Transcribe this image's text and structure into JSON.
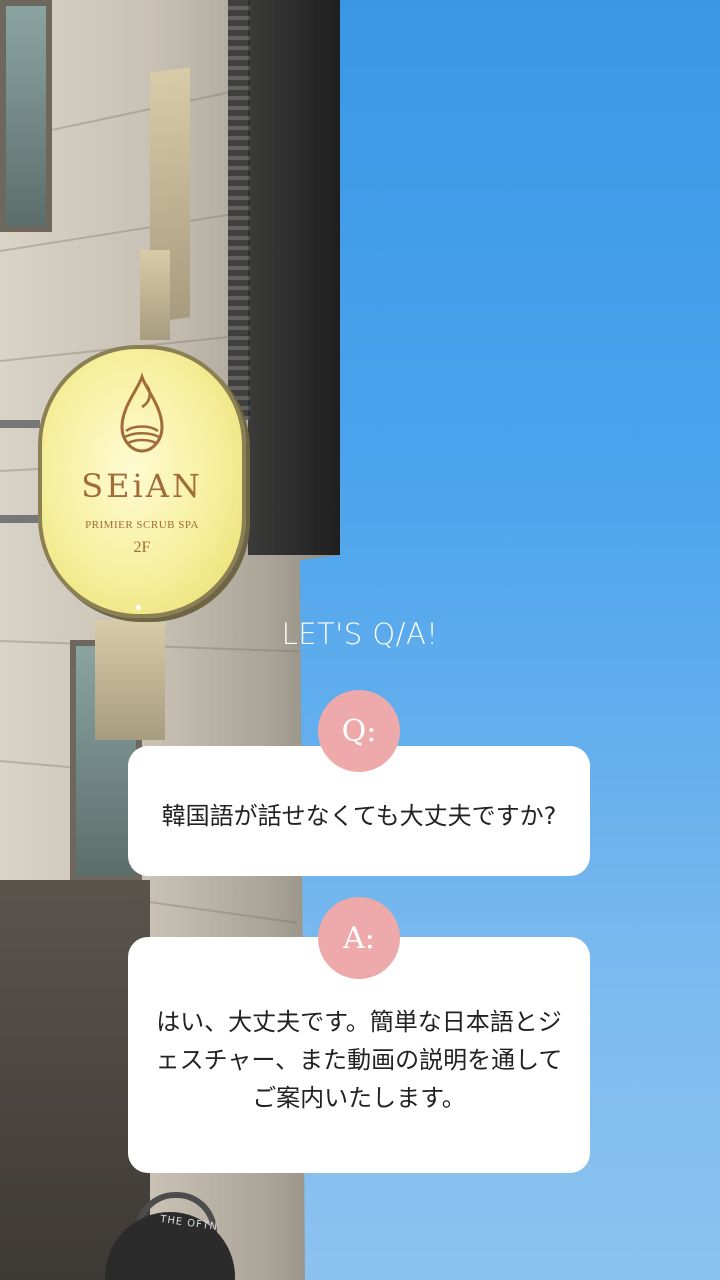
{
  "sign": {
    "brand": "SEiAN",
    "subtitle": "PRIMIER SCRUB SPA",
    "floor": "2F"
  },
  "lamp": {
    "text": "THE OFTN"
  },
  "qa": {
    "heading": "LET'S Q/A!",
    "question_badge": "Q:",
    "question": "韓国語が話せなくても大丈夫ですか?",
    "answer_badge": "A:",
    "answer": "はい、大丈夫です。簡単な日本語とジェスチャー、また動画の説明を通してご案内いたします。"
  },
  "colors": {
    "badge": "#eeaaaa",
    "card": "#ffffff",
    "sky": "#4aa3ec",
    "sign_text": "#a26c3a"
  }
}
